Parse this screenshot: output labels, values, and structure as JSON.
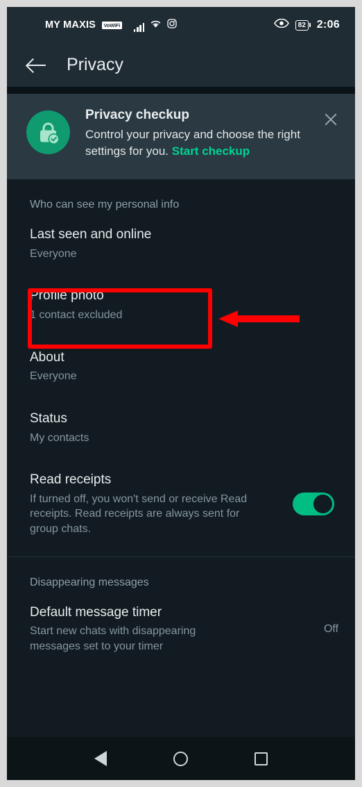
{
  "status_bar": {
    "carrier": "MY MAXIS",
    "vowifi_badge": "VoWiFi",
    "signal_icon": "signal-bars-icon",
    "wifi_icon": "wifi-icon",
    "instagram_icon": "instagram-icon",
    "eye_icon": "eye-icon",
    "battery_percent": "82",
    "time": "2:06"
  },
  "app_bar": {
    "back_icon": "back-arrow-icon",
    "title": "Privacy"
  },
  "banner": {
    "icon": "privacy-lock-check-icon",
    "title": "Privacy checkup",
    "description": "Control your privacy and choose the right settings for you. ",
    "link_label": "Start checkup",
    "close_icon": "close-icon",
    "accent_color": "#00d394",
    "icon_bg_color": "#0f9b6f",
    "bg_color": "#2a3942"
  },
  "sections": [
    {
      "header": "Who can see my personal info",
      "rows": [
        {
          "title": "Last seen and online",
          "subtitle": "Everyone"
        },
        {
          "title": "Profile photo",
          "subtitle": "1 contact excluded"
        },
        {
          "title": "About",
          "subtitle": "Everyone"
        },
        {
          "title": "Status",
          "subtitle": "My contacts"
        },
        {
          "title": "Read receipts",
          "subtitle": "If turned off, you won't send or receive Read receipts. Read receipts are always sent for group chats.",
          "toggle": "on"
        }
      ]
    },
    {
      "header": "Disappearing messages",
      "rows": [
        {
          "title": "Default message timer",
          "subtitle": "Start new chats with disappearing messages set to your timer",
          "value": "Off"
        }
      ]
    }
  ],
  "annotation": {
    "box_target": "profile-photo-row",
    "arrow_direction": "left",
    "color": "#ff0000"
  },
  "nav_bar": {
    "back_icon": "nav-back-triangle-icon",
    "home_icon": "nav-home-circle-icon",
    "recents_icon": "nav-recents-square-icon"
  }
}
